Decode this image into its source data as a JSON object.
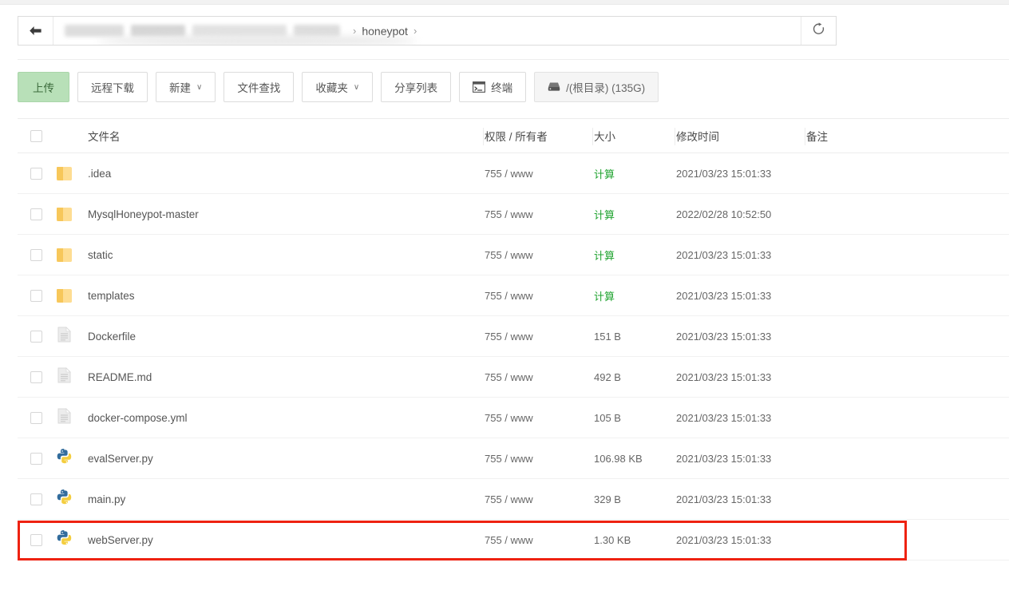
{
  "breadcrumb": {
    "back_icon": "arrow-left-icon",
    "redacted_segments": 4,
    "separator": "›",
    "current": "honeypot",
    "trailing_separator": "›",
    "refresh_icon": "refresh-icon"
  },
  "toolbar": {
    "buttons": [
      {
        "label": "上传",
        "style": "primary",
        "icon": null,
        "caret": false
      },
      {
        "label": "远程下载",
        "style": "default",
        "icon": null,
        "caret": false
      },
      {
        "label": "新建",
        "style": "default",
        "icon": null,
        "caret": true
      },
      {
        "label": "文件查找",
        "style": "default",
        "icon": null,
        "caret": false
      },
      {
        "label": "收藏夹",
        "style": "default",
        "icon": null,
        "caret": true
      },
      {
        "label": "分享列表",
        "style": "default",
        "icon": null,
        "caret": false
      },
      {
        "label": "终端",
        "style": "default",
        "icon": "terminal-icon",
        "caret": false
      },
      {
        "label": "/(根目录) (135G)",
        "style": "disk",
        "icon": "disk-icon",
        "caret": false
      }
    ],
    "caret_glyph": "∨"
  },
  "table": {
    "headers": {
      "name": "文件名",
      "perm": "权限 / 所有者",
      "size": "大小",
      "time": "修改时间",
      "note": "备注"
    },
    "rows": [
      {
        "name": ".idea",
        "icon": "folder-icon",
        "perm": "755 / www",
        "size": "计算",
        "size_is_link": true,
        "time": "2021/03/23 15:01:33",
        "note": "",
        "highlighted": false
      },
      {
        "name": "MysqlHoneypot-master",
        "icon": "folder-icon",
        "perm": "755 / www",
        "size": "计算",
        "size_is_link": true,
        "time": "2022/02/28 10:52:50",
        "note": "",
        "highlighted": false
      },
      {
        "name": "static",
        "icon": "folder-icon",
        "perm": "755 / www",
        "size": "计算",
        "size_is_link": true,
        "time": "2021/03/23 15:01:33",
        "note": "",
        "highlighted": false
      },
      {
        "name": "templates",
        "icon": "folder-icon",
        "perm": "755 / www",
        "size": "计算",
        "size_is_link": true,
        "time": "2021/03/23 15:01:33",
        "note": "",
        "highlighted": false
      },
      {
        "name": "Dockerfile",
        "icon": "file-icon",
        "perm": "755 / www",
        "size": "151 B",
        "size_is_link": false,
        "time": "2021/03/23 15:01:33",
        "note": "",
        "highlighted": false
      },
      {
        "name": "README.md",
        "icon": "file-icon",
        "perm": "755 / www",
        "size": "492 B",
        "size_is_link": false,
        "time": "2021/03/23 15:01:33",
        "note": "",
        "highlighted": false
      },
      {
        "name": "docker-compose.yml",
        "icon": "file-icon",
        "perm": "755 / www",
        "size": "105 B",
        "size_is_link": false,
        "time": "2021/03/23 15:01:33",
        "note": "",
        "highlighted": false
      },
      {
        "name": "evalServer.py",
        "icon": "python-icon",
        "perm": "755 / www",
        "size": "106.98 KB",
        "size_is_link": false,
        "time": "2021/03/23 15:01:33",
        "note": "",
        "highlighted": false
      },
      {
        "name": "main.py",
        "icon": "python-icon",
        "perm": "755 / www",
        "size": "329 B",
        "size_is_link": false,
        "time": "2021/03/23 15:01:33",
        "note": "",
        "highlighted": false
      },
      {
        "name": "webServer.py",
        "icon": "python-icon",
        "perm": "755 / www",
        "size": "1.30 KB",
        "size_is_link": false,
        "time": "2021/03/23 15:01:33",
        "note": "",
        "highlighted": true
      }
    ]
  },
  "colors": {
    "primary_button_bg": "#b8e0b8",
    "link_green": "#1fa32f",
    "highlight_red": "#ee2211",
    "folder_yellow": "#fcd77c",
    "python_blue": "#326c9c",
    "python_yellow": "#f4cd3e"
  }
}
